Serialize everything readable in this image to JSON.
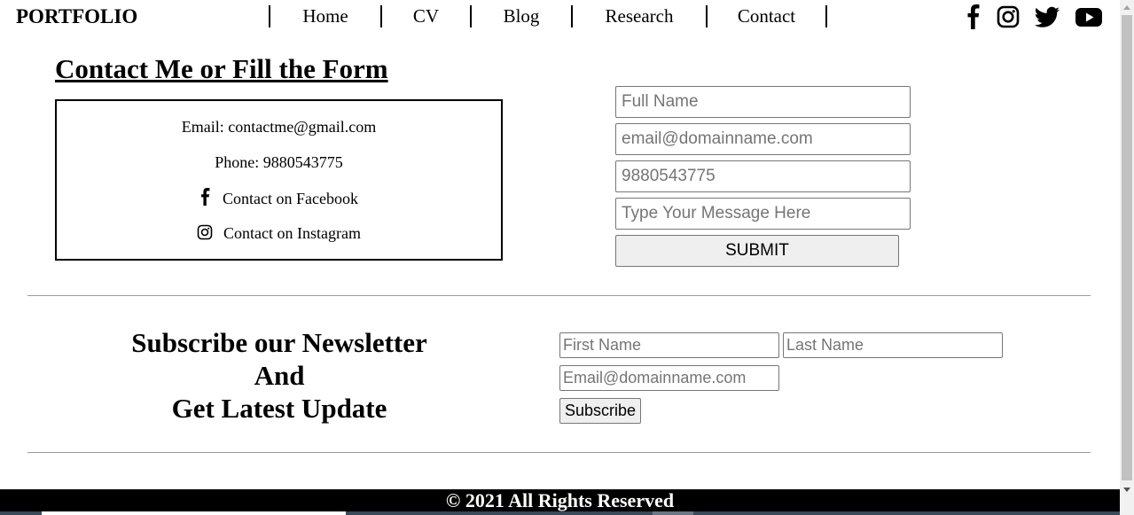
{
  "nav": {
    "brand": "PORTFOLIO",
    "links": [
      "Home",
      "CV",
      "Blog",
      "Research",
      "Contact"
    ],
    "social": [
      "facebook-icon",
      "instagram-icon",
      "twitter-icon",
      "youtube-icon"
    ]
  },
  "contact": {
    "title": "Contact Me or Fill the Form",
    "email_line": "Email: contactme@gmail.com",
    "phone_line": "Phone: 9880543775",
    "facebook_line": "Contact on Facebook",
    "instagram_line": "Contact on Instagram",
    "form": {
      "name_placeholder": "Full Name",
      "email_placeholder": "email@domainname.com",
      "phone_placeholder": "9880543775",
      "message_placeholder": "Type Your Message Here",
      "submit_label": "SUBMIT"
    }
  },
  "newsletter": {
    "title_lines": [
      "Subscribe our Newsletter",
      "And",
      "Get Latest Update"
    ],
    "first_name_placeholder": "First Name",
    "last_name_placeholder": "Last Name",
    "email_placeholder": "Email@domainname.com",
    "subscribe_label": "Subscribe"
  },
  "footer": {
    "text": "© 2021 All Rights Reserved"
  }
}
